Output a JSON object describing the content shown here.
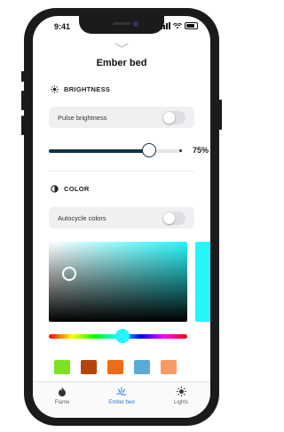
{
  "status": {
    "time": "9:41"
  },
  "header": {
    "title": "Ember bed"
  },
  "brightness": {
    "heading": "BRIGHTNESS",
    "pulse_label": "Pulse brightness",
    "pulse_on": false,
    "value": 0.75,
    "value_label": "75%"
  },
  "color": {
    "heading": "COLOR",
    "autocycle_label": "Autocycle colors",
    "autocycle_on": false,
    "selected_hex": "#26f5fb",
    "picker_saturation": 0.15,
    "picker_brightness": 0.6,
    "hue_fraction": 0.53,
    "swatches": [
      "#7be222",
      "#b5430a",
      "#f06b14",
      "#5aaad6",
      "#f79a65"
    ]
  },
  "tabs": [
    {
      "label": "Flame",
      "icon": "flame-icon",
      "active": false
    },
    {
      "label": "Ember bed",
      "icon": "ember-icon",
      "active": true
    },
    {
      "label": "Lights",
      "icon": "sun-icon",
      "active": false
    }
  ],
  "colors": {
    "accent": "#10344f",
    "tab_active": "#2a78d6"
  }
}
